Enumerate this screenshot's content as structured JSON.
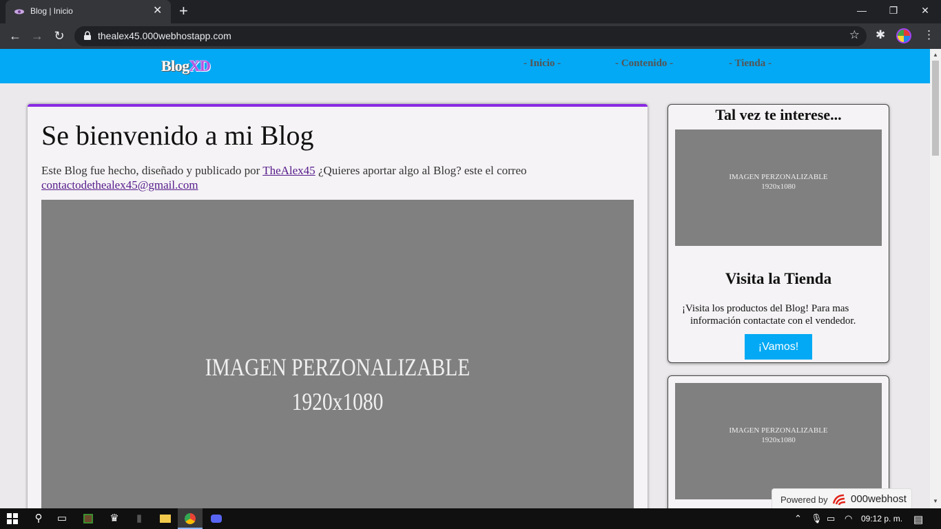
{
  "browser": {
    "tab_title": "Blog | Inicio",
    "tab_close": "✕",
    "new_tab": "+",
    "url": "thealex45.000webhostapp.com",
    "window_controls": {
      "minimize": "—",
      "restore": "❐",
      "close": "✕"
    },
    "nav": {
      "back": "←",
      "forward": "→",
      "reload": "↻"
    },
    "icons": {
      "star": "☆",
      "extensions": "✱",
      "menu": "⋮"
    }
  },
  "site": {
    "logo_part1": "Blog",
    "logo_part2": "XD",
    "nav": [
      "- Inicio -",
      "- Contenido -",
      "- Tienda -"
    ],
    "colors": {
      "header": "#03a9f4",
      "accent": "#8a2be2"
    }
  },
  "main": {
    "title": "Se bienvenido a mi Blog",
    "text_before": "Este Blog fue hecho, diseñado y publicado por ",
    "author_link": "TheAlex45",
    "text_after": " ¿Quieres aportar algo al Blog? este el correo ",
    "email_link": "contactodethealex45@gmail.com",
    "image_line1": "IMAGEN PERZONALIZABLE",
    "image_line2": "1920x1080"
  },
  "sidebar": {
    "title": "Tal vez te interese...",
    "image_line1": "IMAGEN PERZONALIZABLE",
    "image_line2": "1920x1080",
    "shop_title": "Visita la Tienda",
    "shop_text_line1": "¡Visita los productos del Blog! Para mas",
    "shop_text_line2": "información contactate con el vendedor.",
    "shop_button": "¡Vamos!",
    "image2_line1": "IMAGEN PERZONALIZABLE",
    "image2_line2": "1920x1080"
  },
  "powered_by": {
    "label": "Powered by",
    "brand": "000webhost"
  },
  "taskbar": {
    "clock": "09:12 p. m."
  }
}
